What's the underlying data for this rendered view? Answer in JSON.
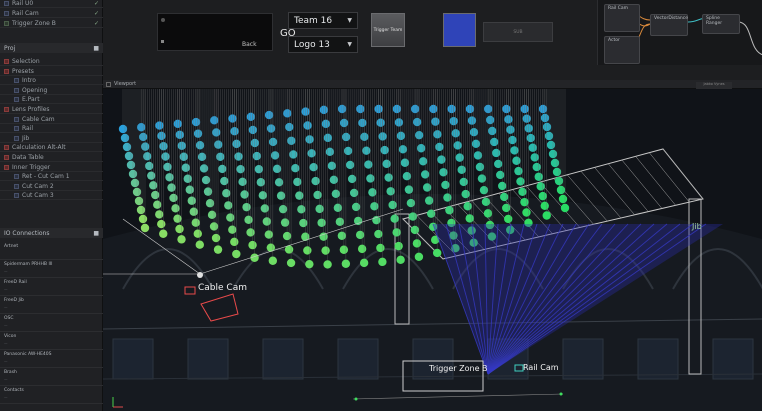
{
  "outliner": {
    "items": [
      {
        "label": "Rail U0",
        "type": "b"
      },
      {
        "label": "Rail Cam",
        "type": "b"
      },
      {
        "label": "Trigger Zone B",
        "type": "g"
      }
    ]
  },
  "project": {
    "title": "Proj",
    "items": [
      {
        "label": "Selection",
        "indent": 0
      },
      {
        "label": "Presets",
        "indent": 0
      },
      {
        "label": "Intro",
        "indent": 1
      },
      {
        "label": "Opening",
        "indent": 1
      },
      {
        "label": "E.Part",
        "indent": 1
      },
      {
        "label": "Lens Profiles",
        "indent": 0
      },
      {
        "label": "Cable Cam",
        "indent": 1
      },
      {
        "label": "Rail",
        "indent": 1
      },
      {
        "label": "Jib",
        "indent": 1
      },
      {
        "label": "Calculation Alt-Alt",
        "indent": 0
      },
      {
        "label": "Data Table",
        "indent": 0
      },
      {
        "label": "Inner Trigger",
        "indent": 0
      },
      {
        "label": "Ret - Cut Cam 1",
        "indent": 1
      },
      {
        "label": "Cut Cam 2",
        "indent": 1
      },
      {
        "label": "Cut Cam 3",
        "indent": 1
      }
    ]
  },
  "io": {
    "title": "IO Connections",
    "items": [
      {
        "name": "Artnet",
        "sub": ""
      },
      {
        "name": "Spidermam PRHHB III",
        "sub": "—"
      },
      {
        "name": "FreeD Rail",
        "sub": "—"
      },
      {
        "name": "FreeD Jib",
        "sub": "—"
      },
      {
        "name": "OSC",
        "sub": "—"
      },
      {
        "name": "Vicon",
        "sub": "—"
      },
      {
        "name": "Panasonic AW-HE40S",
        "sub": "—"
      },
      {
        "name": "Brash",
        "sub": "—"
      },
      {
        "name": "Contacts",
        "sub": "—"
      }
    ]
  },
  "control": {
    "go_label": "GO",
    "back_label": "Back",
    "team_select": "Team 16",
    "logo_select": "Logo 13",
    "trigger_team_label": "Trigger Team",
    "color_swatch": "#2f44b8",
    "sub_button_label": "SUB",
    "accent": "#3a8fdb"
  },
  "graph": {
    "nodes": [
      {
        "label": "Rail Cam"
      },
      {
        "label": "VectorDistance"
      },
      {
        "label": "Spline Ranger"
      },
      {
        "label": "Actor"
      }
    ]
  },
  "viewport": {
    "tab_label": "Viewport",
    "toolbar_right": "Jabko Vynes",
    "labels": {
      "cable_cam": "Cable Cam",
      "trigger_zone": "Trigger Zone B",
      "rail_cam": "Rail Cam",
      "jib": "Jib"
    }
  }
}
